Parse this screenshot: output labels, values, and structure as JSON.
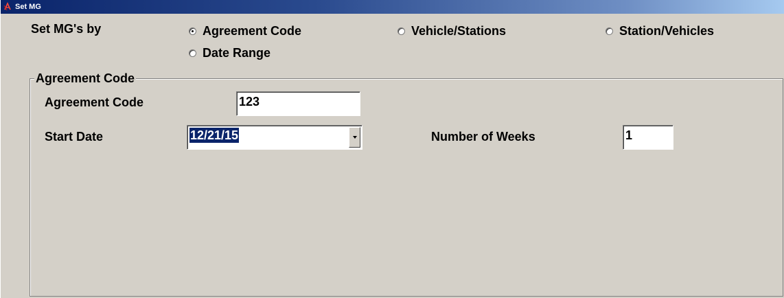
{
  "window": {
    "title": "Set MG",
    "title_icon": "app-icon",
    "accent_color": "#0a246a"
  },
  "set_by": {
    "label": "Set MG's by",
    "options": [
      {
        "label": "Agreement Code",
        "checked": true
      },
      {
        "label": "Vehicle/Stations",
        "checked": false
      },
      {
        "label": "Station/Vehicles",
        "checked": false
      },
      {
        "label": "Date Range",
        "checked": false
      }
    ]
  },
  "agreement_group": {
    "title": "Agreement Code",
    "agreement_code_label": "Agreement Code",
    "agreement_code_value": "123",
    "start_date_label": "Start Date",
    "start_date_value": "12/21/15",
    "weeks_label": "Number of Weeks",
    "weeks_value": "1"
  }
}
